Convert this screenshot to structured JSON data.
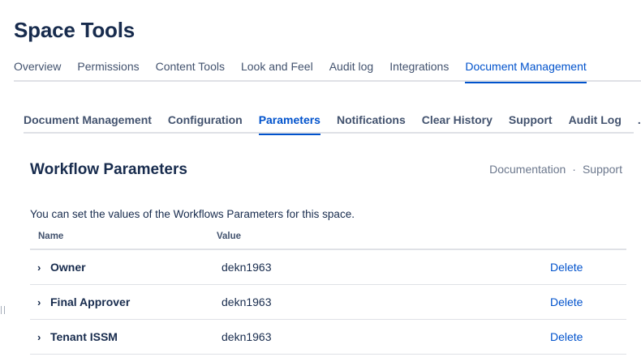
{
  "page": {
    "title": "Space Tools"
  },
  "top_tabs": [
    {
      "label": "Overview"
    },
    {
      "label": "Permissions"
    },
    {
      "label": "Content Tools"
    },
    {
      "label": "Look and Feel"
    },
    {
      "label": "Audit log"
    },
    {
      "label": "Integrations"
    },
    {
      "label": "Document Management",
      "active": true
    }
  ],
  "sub_tabs": [
    {
      "label": "Document Management"
    },
    {
      "label": "Configuration"
    },
    {
      "label": "Parameters",
      "active": true
    },
    {
      "label": "Notifications"
    },
    {
      "label": "Clear History"
    },
    {
      "label": "Support"
    },
    {
      "label": "Audit Log"
    },
    {
      "label": "..."
    }
  ],
  "section": {
    "title": "Workflow Parameters",
    "links": {
      "documentation": "Documentation",
      "separator": "·",
      "support": "Support"
    },
    "description": "You can set the values of the Workflows Parameters for this space."
  },
  "table": {
    "headers": {
      "name": "Name",
      "value": "Value"
    },
    "rows": [
      {
        "name": "Owner",
        "value": "dekn1963",
        "action": "Delete"
      },
      {
        "name": "Final Approver",
        "value": "dekn1963",
        "action": "Delete"
      },
      {
        "name": "Tenant ISSM",
        "value": "dekn1963",
        "action": "Delete"
      }
    ]
  },
  "icons": {
    "row_expand": "chevron-right-icon",
    "resize_handle": "drag-handle-icon"
  },
  "colors": {
    "primary": "#0052cc",
    "text": "#172b4d",
    "muted": "#6b778c",
    "border": "#dfe1e6"
  }
}
